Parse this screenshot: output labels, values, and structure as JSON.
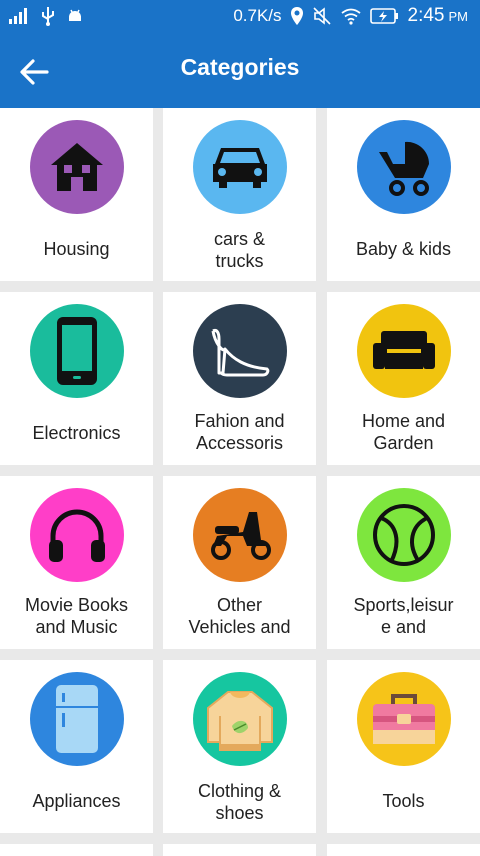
{
  "status": {
    "speed": "0.7K/s",
    "time": "2:45",
    "ampm": "PM"
  },
  "header": {
    "title": "Categories"
  },
  "categories": [
    {
      "label": "Housing",
      "color": "#9b59b6",
      "icon": "house-icon"
    },
    {
      "label": "cars &\ntrucks",
      "color": "#5ab7f0",
      "icon": "car-icon"
    },
    {
      "label": "Baby & kids",
      "color": "#2e86de",
      "icon": "stroller-icon"
    },
    {
      "label": "Electronics",
      "color": "#1abc9c",
      "icon": "phone-icon"
    },
    {
      "label": "Fahion and\nAccessoris",
      "color": "#2c3e50",
      "icon": "high-heel-icon"
    },
    {
      "label": "Home and\nGarden",
      "color": "#f1c40f",
      "icon": "sofa-icon"
    },
    {
      "label": "Movie Books\nand Music",
      "color": "#ff3ec8",
      "icon": "headphones-icon"
    },
    {
      "label": "Other\nVehicles and",
      "color": "#e67e22",
      "icon": "scooter-icon"
    },
    {
      "label": "Sports,leisur\ne and",
      "color": "#7ee63e",
      "icon": "tennis-ball-icon"
    },
    {
      "label": "Appliances",
      "color": "#2e86de",
      "icon": "fridge-icon"
    },
    {
      "label": "Clothing &\nshoes",
      "color": "#16c6a0",
      "icon": "sweater-icon"
    },
    {
      "label": "Tools",
      "color": "#f6c419",
      "icon": "toolbox-icon"
    }
  ]
}
